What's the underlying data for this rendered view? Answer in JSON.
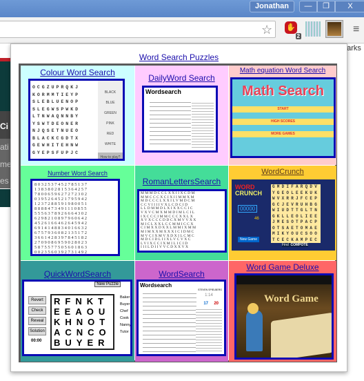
{
  "window": {
    "user": "Jonathan",
    "min": "—",
    "restore": "❐",
    "close": "X"
  },
  "toolbar": {
    "star_icon": "☆",
    "badge": "2",
    "bookmarks_partial": "harks"
  },
  "background_text": [
    "Ci",
    "ati",
    "me",
    "es"
  ],
  "popup": {
    "title": "Word Search Puzzles",
    "items": [
      {
        "label": "Colour Word Search",
        "bg": "#ccffff",
        "words": [
          "BLACK",
          "BLUE",
          "GREEN",
          "PINK",
          "RED",
          "WHITE"
        ],
        "help": "How to play?",
        "grid": [
          "OCGZUPRQKJ",
          "KORMMTIEYP",
          "SLEBLUENOP",
          "SLEGWSPWKD",
          "LTNWAQNNBY",
          "YSWTDEONER",
          "NJQSETNUEO",
          "BLACKCGDTX",
          "GEWHITEHNW",
          "GYEPSFUPJC"
        ]
      },
      {
        "label": "DailyWord Search",
        "heading": "Wordsearch"
      },
      {
        "label": "Math equation Word Search",
        "logo": "Math Search",
        "menu": [
          "START",
          "HIGH SCORES",
          "MORE GAMES"
        ]
      },
      {
        "label": "Number Word Search",
        "grid": [
          "8032537452785137",
          "1383802815364257",
          "7800659627272302",
          "0395264521795942",
          "1237288591980051",
          "8888473491110855",
          "5556378926664302",
          "6298210897960642",
          "4526166462645942",
          "6914148834016632",
          "6757936082135172",
          "3661428397845182",
          "2709086959028023",
          "5875577505601863",
          "0023560392731492"
        ]
      },
      {
        "label": "RomanLettersSearch",
        "grid": [
          "MMMDCCLXXIIXCDM",
          "MMCCCXCIXIIMMXM",
          "MDCCCLXXILVMDCM",
          "CCVIIIIVXLCDCID",
          "LLDMMDLXIXXCCIC",
          "VXVCMXMMDIMLCIL",
          "IXCCCIMMCCCXXLX",
          "XVXCCCDDCXMVVXX",
          "MICLXXLCCMMICCX",
          "CIMXXDXXLMMIXMM",
          "MIMXXMXXXICIDMC",
          "MVCIXMVXDXILCMC",
          "MDCIDLIIXLVCVXC",
          "LVIXCCIXMILICID",
          "IIILDIIVVCDXXVX"
        ]
      },
      {
        "label": "WordCrunch",
        "logo1": "WORD",
        "logo2": "CRUNCH",
        "score": "00000",
        "points": "46",
        "new_game": "New Game",
        "find": "Find",
        "current_word": "COMPOTE",
        "grid": [
          "GMDIFARQDV",
          "YGEOLEEKUK",
          "WVXRRJFCEP",
          "GCJEVRUHBG",
          "WIUDTTGLTN",
          "GKLLEOLIEE",
          "JMESOTPACP",
          "OTSAETOMAE",
          "MIKYOUCSOO",
          "TCECKAMPEC"
        ]
      },
      {
        "label": "QuickWordSearch",
        "new_puzzle": "New Puzzle",
        "buttons": [
          "Revert",
          "Check",
          "Reveal",
          "Solution"
        ],
        "timer": "00:00",
        "grid": [
          "RFNKT",
          "EEAOU",
          "KHNOT",
          "ACNCO",
          "BUYER"
        ],
        "words": [
          "Baker",
          "Buyer",
          "Chef",
          "Cook",
          "Nanny",
          "Tutor"
        ]
      },
      {
        "label": "WordSearch",
        "heading": "Wordsearch",
        "author": "STEVEN SPIELBERG",
        "time": "1:14",
        "found": "17",
        "left": "20"
      },
      {
        "label": "Word Game Deluxe",
        "logo": "Word Game"
      }
    ]
  },
  "colors": {
    "cell_bgs": [
      "#ccffff",
      "#ffccff",
      "#ffcccc",
      "#66ff99",
      "#44dd99",
      "#ffcc33",
      "#339999",
      "#cc66cc",
      "#ff6666"
    ],
    "link": "#1a0dab",
    "thumb_border": "#0a0ab4"
  }
}
